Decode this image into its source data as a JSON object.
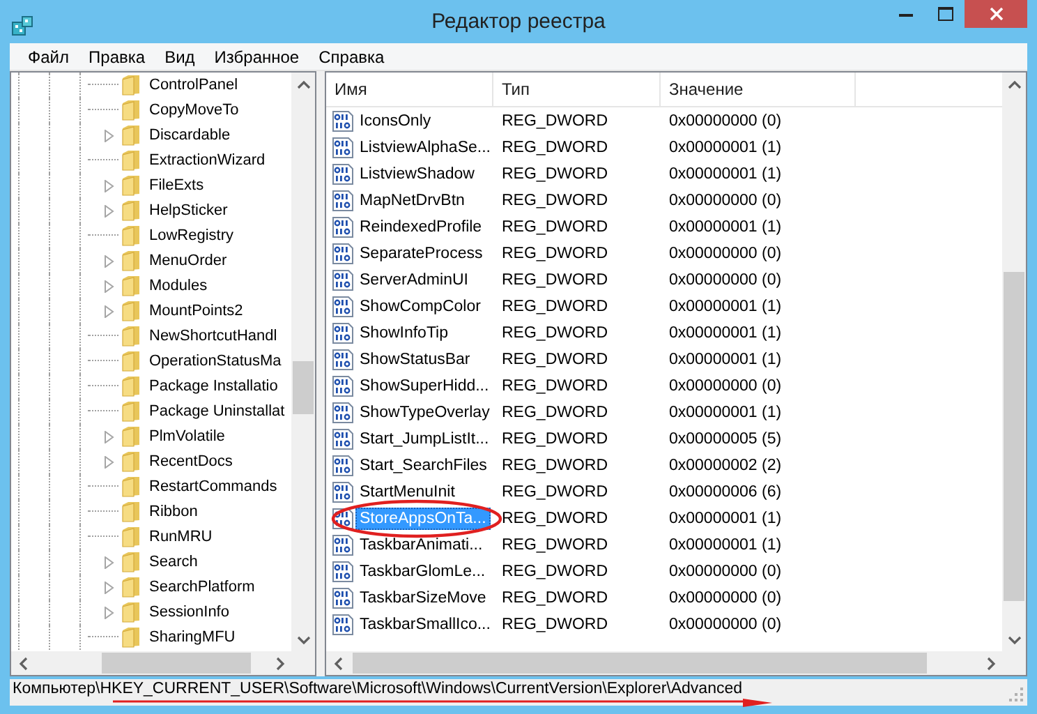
{
  "window": {
    "title": "Редактор реестра"
  },
  "menu": [
    "Файл",
    "Правка",
    "Вид",
    "Избранное",
    "Справка"
  ],
  "tree": [
    {
      "label": "ControlPanel",
      "expandable": false
    },
    {
      "label": "CopyMoveTo",
      "expandable": false
    },
    {
      "label": "Discardable",
      "expandable": true
    },
    {
      "label": "ExtractionWizard",
      "expandable": false
    },
    {
      "label": "FileExts",
      "expandable": true
    },
    {
      "label": "HelpSticker",
      "expandable": true
    },
    {
      "label": "LowRegistry",
      "expandable": false
    },
    {
      "label": "MenuOrder",
      "expandable": true
    },
    {
      "label": "Modules",
      "expandable": true
    },
    {
      "label": "MountPoints2",
      "expandable": true
    },
    {
      "label": "NewShortcutHandl",
      "expandable": false
    },
    {
      "label": "OperationStatusMa",
      "expandable": false
    },
    {
      "label": "Package Installatio",
      "expandable": false
    },
    {
      "label": "Package Uninstallat",
      "expandable": false
    },
    {
      "label": "PlmVolatile",
      "expandable": true
    },
    {
      "label": "RecentDocs",
      "expandable": true
    },
    {
      "label": "RestartCommands",
      "expandable": false
    },
    {
      "label": "Ribbon",
      "expandable": false
    },
    {
      "label": "RunMRU",
      "expandable": false
    },
    {
      "label": "Search",
      "expandable": true
    },
    {
      "label": "SearchPlatform",
      "expandable": true
    },
    {
      "label": "SessionInfo",
      "expandable": true
    },
    {
      "label": "SharingMFU",
      "expandable": false
    }
  ],
  "table": {
    "columns": [
      "Имя",
      "Тип",
      "Значение"
    ],
    "rows": [
      {
        "name": "IconsOnly",
        "type": "REG_DWORD",
        "data": "0x00000000 (0)",
        "selected": false
      },
      {
        "name": "ListviewAlphaSe...",
        "type": "REG_DWORD",
        "data": "0x00000001 (1)",
        "selected": false
      },
      {
        "name": "ListviewShadow",
        "type": "REG_DWORD",
        "data": "0x00000001 (1)",
        "selected": false
      },
      {
        "name": "MapNetDrvBtn",
        "type": "REG_DWORD",
        "data": "0x00000000 (0)",
        "selected": false
      },
      {
        "name": "ReindexedProfile",
        "type": "REG_DWORD",
        "data": "0x00000001 (1)",
        "selected": false
      },
      {
        "name": "SeparateProcess",
        "type": "REG_DWORD",
        "data": "0x00000000 (0)",
        "selected": false
      },
      {
        "name": "ServerAdminUI",
        "type": "REG_DWORD",
        "data": "0x00000000 (0)",
        "selected": false
      },
      {
        "name": "ShowCompColor",
        "type": "REG_DWORD",
        "data": "0x00000001 (1)",
        "selected": false
      },
      {
        "name": "ShowInfoTip",
        "type": "REG_DWORD",
        "data": "0x00000001 (1)",
        "selected": false
      },
      {
        "name": "ShowStatusBar",
        "type": "REG_DWORD",
        "data": "0x00000001 (1)",
        "selected": false
      },
      {
        "name": "ShowSuperHidd...",
        "type": "REG_DWORD",
        "data": "0x00000000 (0)",
        "selected": false
      },
      {
        "name": "ShowTypeOverlay",
        "type": "REG_DWORD",
        "data": "0x00000001 (1)",
        "selected": false
      },
      {
        "name": "Start_JumpListIt...",
        "type": "REG_DWORD",
        "data": "0x00000005 (5)",
        "selected": false
      },
      {
        "name": "Start_SearchFiles",
        "type": "REG_DWORD",
        "data": "0x00000002 (2)",
        "selected": false
      },
      {
        "name": "StartMenuInit",
        "type": "REG_DWORD",
        "data": "0x00000006 (6)",
        "selected": false
      },
      {
        "name": "StoreAppsOnTa...",
        "type": "REG_DWORD",
        "data": "0x00000001 (1)",
        "selected": true
      },
      {
        "name": "TaskbarAnimati...",
        "type": "REG_DWORD",
        "data": "0x00000001 (1)",
        "selected": false
      },
      {
        "name": "TaskbarGlomLe...",
        "type": "REG_DWORD",
        "data": "0x00000000 (0)",
        "selected": false
      },
      {
        "name": "TaskbarSizeMove",
        "type": "REG_DWORD",
        "data": "0x00000000 (0)",
        "selected": false
      },
      {
        "name": "TaskbarSmallIco...",
        "type": "REG_DWORD",
        "data": "0x00000000 (0)",
        "selected": false
      }
    ]
  },
  "status_bar": "Компьютер\\HKEY_CURRENT_USER\\Software\\Microsoft\\Windows\\CurrentVersion\\Explorer\\Advanced"
}
